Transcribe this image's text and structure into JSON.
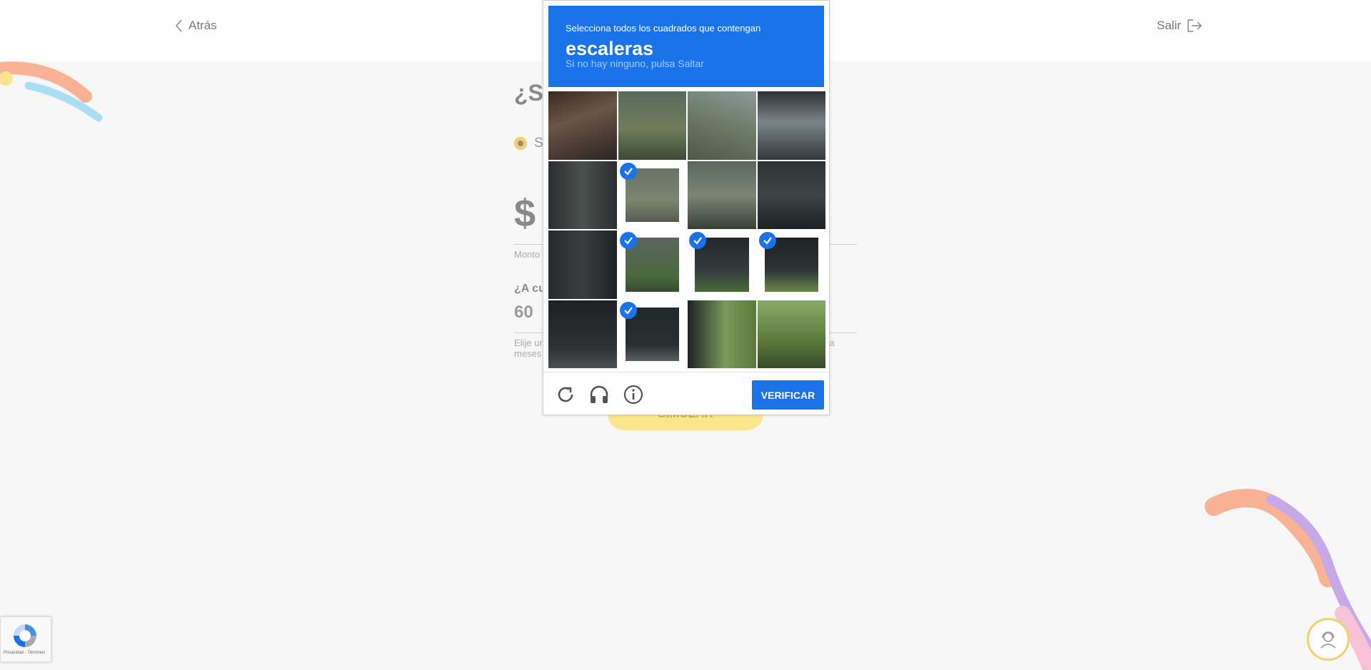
{
  "nav": {
    "back_label": "Atrás",
    "exit_label": "Salir"
  },
  "form": {
    "title_partial": "¿Sa",
    "radio_partial": "S",
    "amount_sign": "$",
    "amount_help_partial": "Monto",
    "months_question_partial": "¿A cu",
    "months_value": "60",
    "months_help_partial_left": "Elije un",
    "months_help_partial_left_2": "meses",
    "months_help_partial_right": "ara",
    "simulate_label": "SIMULAR"
  },
  "captcha": {
    "instruction": "Selecciona todos los cuadrados que contengan",
    "target": "escaleras",
    "subtitle": "Si no hay ninguno, pulsa Saltar",
    "verify_label": "VERIFICAR",
    "selected_tiles": [
      5,
      9,
      10,
      11,
      13
    ],
    "tiles": [
      {
        "style": "t0"
      },
      {
        "style": "t1"
      },
      {
        "style": "t2"
      },
      {
        "style": "t3"
      },
      {
        "style": "t4"
      },
      {
        "style": "t5"
      },
      {
        "style": "t6"
      },
      {
        "style": "t7"
      },
      {
        "style": "t8"
      },
      {
        "style": "t9"
      },
      {
        "style": "t10"
      },
      {
        "style": "t11"
      },
      {
        "style": "t12"
      },
      {
        "style": "t13"
      },
      {
        "style": "t14"
      },
      {
        "style": "t15"
      }
    ],
    "icons": [
      "reload-icon",
      "headphones-icon",
      "info-icon"
    ],
    "accent_color": "#1a73e8"
  },
  "recaptcha_badge": {
    "text": "Privacidad - Términos"
  },
  "colors": {
    "brand_yellow": "#fbe68d",
    "deco_peach": "#f9b394",
    "deco_blue": "#a9dff2",
    "deco_purple": "#c7a9e8",
    "deco_pink": "#f6c3d6"
  }
}
